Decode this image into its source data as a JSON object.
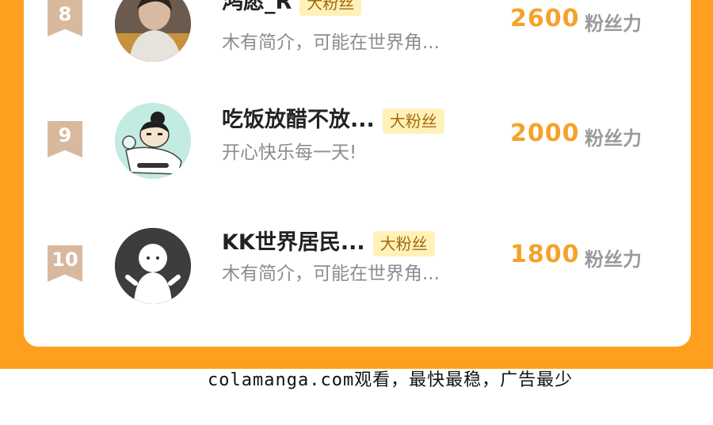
{
  "ranking": {
    "entries": [
      {
        "rank": "8",
        "name": "鸿愿_R",
        "badge": "大粉丝",
        "intro": "木有简介，可能在世界角...",
        "score": "2600",
        "unit": "粉丝力",
        "avatar": "photo-person-avatar"
      },
      {
        "rank": "9",
        "name": "吃饭放醋不放...",
        "badge": "大粉丝",
        "intro": "开心快乐每一天!",
        "score": "2000",
        "unit": "粉丝力",
        "avatar": "cartoon-boy-avatar"
      },
      {
        "rank": "10",
        "name": "KK世界居民...",
        "badge": "大粉丝",
        "intro": "木有简介，可能在世界角...",
        "score": "1800",
        "unit": "粉丝力",
        "avatar": "default-ghost-avatar"
      }
    ]
  },
  "footer": {
    "text": "colamanga.com观看，最快最稳，广告最少"
  },
  "colors": {
    "frame": "#ff9f1f",
    "score": "#f6a12a",
    "badge_bg": "#fff1b8",
    "rank_bg": "#d8b99e"
  }
}
